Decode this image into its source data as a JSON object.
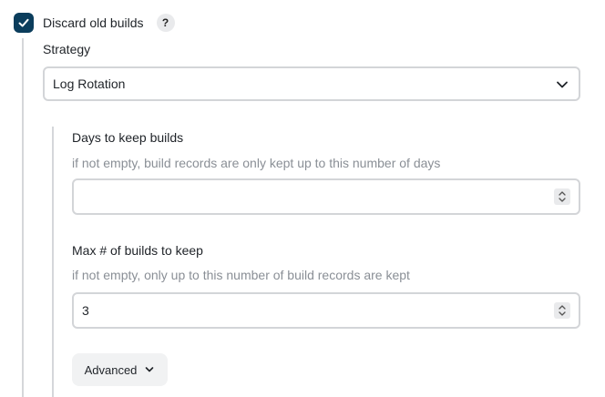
{
  "discard": {
    "label": "Discard old builds",
    "checked": true,
    "help_label": "?"
  },
  "strategy": {
    "label": "Strategy",
    "selected": "Log Rotation"
  },
  "days_to_keep": {
    "label": "Days to keep builds",
    "description": "if not empty, build records are only kept up to this number of days",
    "value": ""
  },
  "max_builds": {
    "label": "Max # of builds to keep",
    "description": "if not empty, only up to this number of build records are kept",
    "value": "3"
  },
  "advanced": {
    "label": "Advanced"
  },
  "colors": {
    "checkbox_fill": "#0b3d5c",
    "rail": "#d5d7da",
    "description_text": "#8a8f96"
  }
}
